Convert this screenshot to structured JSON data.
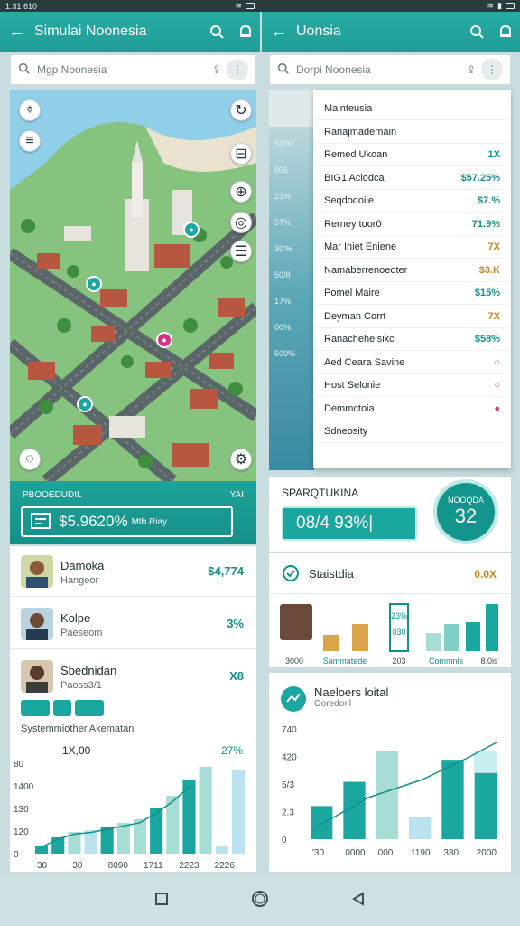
{
  "status": {
    "time": "1:31 610",
    "right_icons": "signal-wifi-battery"
  },
  "left": {
    "title": "Simulai Noonesia",
    "search_placeholder": "Mgp Noonesia",
    "promo": {
      "label": "PBOOEDUDIL",
      "label_right": "YAI",
      "value": "$5.9620%",
      "value_sub": "Mtb Riay"
    },
    "people": [
      {
        "name": "Damoka",
        "sub": "Hangeor",
        "value": "$4,774"
      },
      {
        "name": "Kolpe",
        "sub": "Paeseom",
        "value": "3%"
      },
      {
        "name": "Sbednidan",
        "sub": "Paoss3/1",
        "value": "X8"
      }
    ],
    "chart": {
      "title": "Systemmiother Akematan",
      "y_ticks": [
        "80",
        "1400",
        "130",
        "120",
        "0"
      ],
      "headline": "1X,00",
      "headline_pct": "27%",
      "x_ticks": [
        "30",
        "30",
        "8090",
        "1711",
        "2223",
        "2226"
      ]
    }
  },
  "right": {
    "title": "Uonsia",
    "search_placeholder": "Dorpi Noonesia",
    "strip_labels": [
      "S000",
      "606",
      "23%",
      "57%",
      "3C%",
      "50/8",
      "17%",
      "00%",
      "500%"
    ],
    "menu": [
      {
        "label": "Mainteusia",
        "value": "",
        "color": "#14908a"
      },
      {
        "label": "Ranajmademain",
        "value": "",
        "color": "#14908a"
      },
      {
        "label": "Remed Ukoan",
        "value": "1X",
        "color": "#14908a"
      },
      {
        "label": "BIG1 Aclodca",
        "value": "$57.25%",
        "color": "#14908a"
      },
      {
        "label": "Seqdodoiie",
        "value": "$7.%",
        "color": "#14908a"
      },
      {
        "label": "Rerney toor0",
        "value": "71.9%",
        "color": "#14908a"
      },
      {
        "label": "Mar Iniet Eniene",
        "value": "7X",
        "color": "#c28a23"
      },
      {
        "label": "Namaberrenoeoter",
        "value": "$3.K",
        "color": "#c28a23"
      },
      {
        "label": "Pomel Maire",
        "value": "$15%",
        "color": "#14908a"
      },
      {
        "label": "Deyman Corrt",
        "value": "7X",
        "color": "#c28a23"
      },
      {
        "label": "Ranacheheisikc",
        "value": "$58%",
        "color": "#14908a"
      },
      {
        "label": "Aed Ceara Savine",
        "value": "○",
        "color": "#c54a6a"
      },
      {
        "label": "Host Selonie",
        "value": "○",
        "color": "#c54a6a"
      },
      {
        "label": "Demmctoia",
        "value": "●",
        "color": "#c54a6a"
      },
      {
        "label": "Sdneosity",
        "value": "",
        "color": "#14908a"
      }
    ],
    "summary": {
      "label": "SPARQTUKINA",
      "value": "08/4 93%|",
      "ring_label": "NOOQDA",
      "ring_value": "32"
    },
    "stat": {
      "title": "Staistdia",
      "value": "0.0X",
      "bar_labels": [
        "3000",
        "Sammatede",
        "203",
        "Commnis",
        "8.0is"
      ],
      "tag_top": "23%",
      "tag_mid": "030"
    },
    "chart": {
      "title": "Naeloers loital",
      "subtitle": "Ooredonl",
      "y_ticks": [
        "740",
        "420",
        "5/3",
        "2.3",
        "0"
      ],
      "x_ticks": [
        "'30",
        "0000",
        "000",
        "1190",
        "330",
        "2000"
      ]
    }
  },
  "chart_data": [
    {
      "type": "bar",
      "title": "Systemmiother Akematan",
      "categories": [
        "30",
        "30",
        "8090",
        "1711",
        "2223",
        "2226"
      ],
      "series": [
        {
          "values": [
            8,
            18,
            24,
            26,
            30,
            34,
            38,
            50,
            64,
            82,
            96,
            8,
            92
          ]
        }
      ],
      "ylim": [
        0,
        100
      ]
    },
    {
      "type": "bar",
      "title": "Naeloers loital",
      "categories": [
        "'30",
        "0000",
        "000",
        "1190",
        "330",
        "2000"
      ],
      "series": [
        {
          "values": [
            30,
            52,
            80,
            20,
            72,
            80
          ]
        }
      ],
      "ylim": [
        0,
        100
      ]
    }
  ]
}
